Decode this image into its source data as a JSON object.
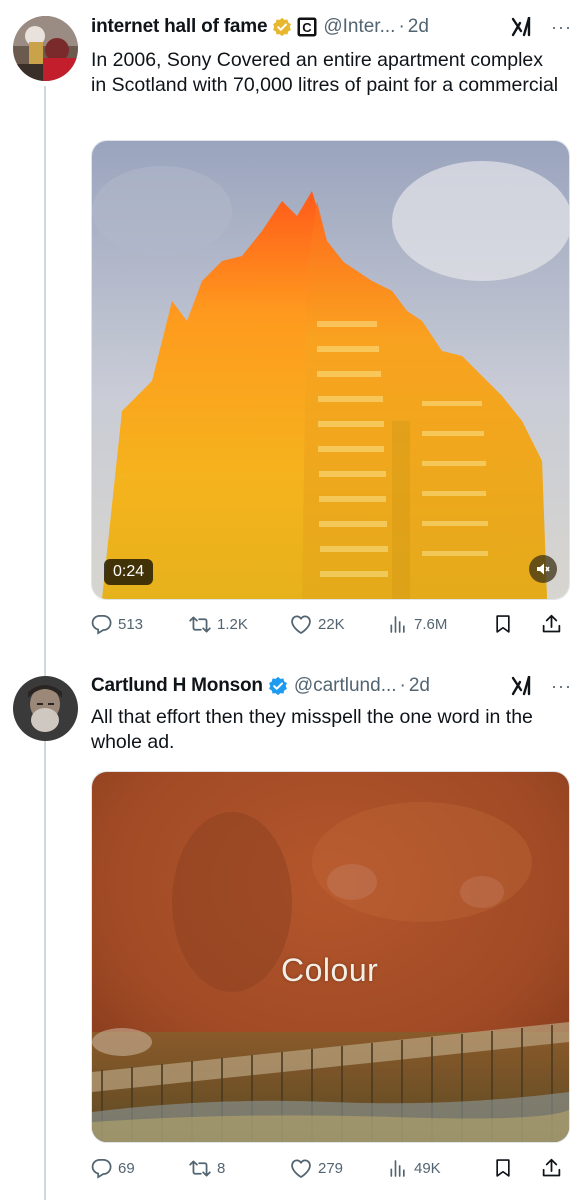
{
  "tweets": [
    {
      "display_name": "internet hall of fame",
      "handle": "@Inter...",
      "separator": "·",
      "time": "2d",
      "text": "In 2006, Sony Covered an entire apartment complex in Scotland with 70,000 litres of paint for a commercial",
      "video_duration": "0:24",
      "stats": {
        "replies": "513",
        "reposts": "1.2K",
        "likes": "22K",
        "views": "7.6M"
      }
    },
    {
      "display_name": "Cartlund H Monson",
      "handle": "@cartlund...",
      "separator": "·",
      "time": "2d",
      "text": "All that effort then they misspell the one word in the whole ad.",
      "video_caption": "Colour",
      "stats": {
        "replies": "69",
        "reposts": "8",
        "likes": "279",
        "views": "49K"
      }
    }
  ],
  "more_label": "···",
  "icons": {
    "verified_gold": "verified-gold-badge-icon",
    "affiliate": "affiliate-c-badge-icon",
    "verified_blue": "verified-blue-badge-icon",
    "grok": "grok-icon",
    "reply": "reply-icon",
    "repost": "repost-icon",
    "like": "like-icon",
    "views": "views-icon",
    "bookmark": "bookmark-icon",
    "share": "share-icon",
    "mute": "mute-icon"
  },
  "colors": {
    "text": "#0f1419",
    "secondary": "#536471",
    "verified_blue": "#1d9bf0",
    "verified_gold": "#e8b730",
    "thread_line": "#cfd9de"
  }
}
